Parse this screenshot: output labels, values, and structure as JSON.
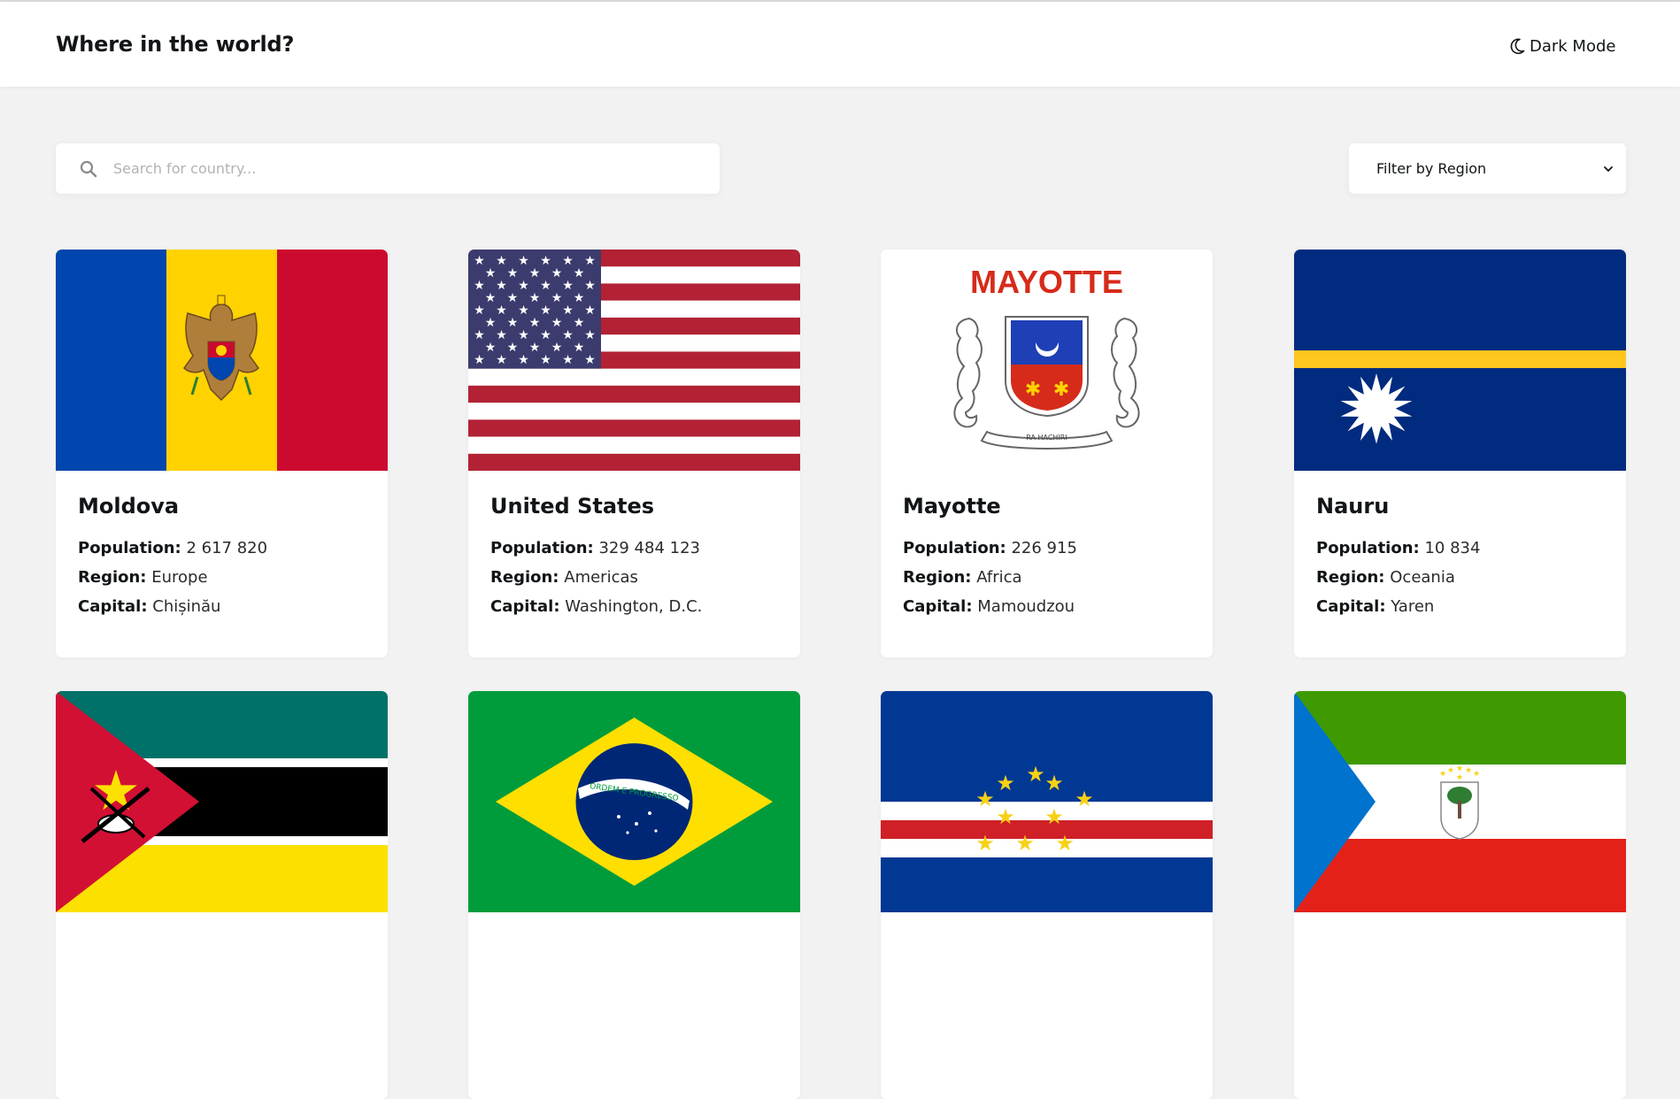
{
  "header": {
    "title": "Where in the world?",
    "theme_toggle_label": "Dark Mode"
  },
  "search": {
    "placeholder": "Search for country..."
  },
  "filter": {
    "label": "Filter by Region"
  },
  "labels": {
    "population": "Population:",
    "region": "Region:",
    "capital": "Capital:"
  },
  "countries": [
    {
      "name": "Moldova",
      "population": "2 617 820",
      "region": "Europe",
      "capital": "Chișinău",
      "flag": "moldova-flag"
    },
    {
      "name": "United States",
      "population": "329 484 123",
      "region": "Americas",
      "capital": "Washington, D.C.",
      "flag": "usa-flag"
    },
    {
      "name": "Mayotte",
      "population": "226 915",
      "region": "Africa",
      "capital": "Mamoudzou",
      "flag": "mayotte-flag",
      "flag_text": "MAYOTTE",
      "flag_motto": "RA HACHIRI"
    },
    {
      "name": "Nauru",
      "population": "10 834",
      "region": "Oceania",
      "capital": "Yaren",
      "flag": "nauru-flag"
    },
    {
      "flag": "mozambique-flag"
    },
    {
      "flag": "brazil-flag",
      "flag_motto": "ORDEM E PROGRESSO"
    },
    {
      "flag": "cape-verde-flag"
    },
    {
      "flag": "equatorial-guinea-flag"
    }
  ],
  "colors": {
    "background": "#f2f2f2",
    "surface": "#ffffff",
    "text": "#111517",
    "placeholder": "#b2b2b2"
  }
}
